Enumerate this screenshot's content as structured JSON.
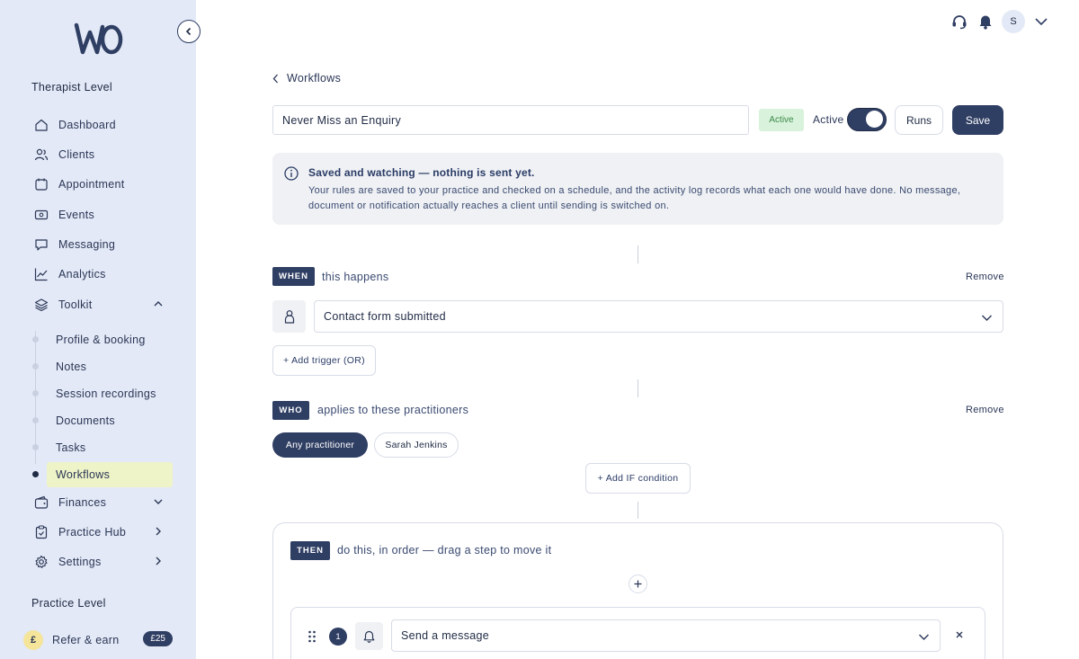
{
  "app": {
    "logo_text": "wo"
  },
  "sidebar": {
    "therapist_level": "Therapist Level",
    "practice_level": "Practice Level",
    "items": [
      {
        "label": "Dashboard",
        "icon": "home-icon"
      },
      {
        "label": "Clients",
        "icon": "users-icon"
      },
      {
        "label": "Appointment",
        "icon": "calendar-icon"
      },
      {
        "label": "Events",
        "icon": "ticket-icon"
      },
      {
        "label": "Messaging",
        "icon": "chat-icon"
      },
      {
        "label": "Analytics",
        "icon": "chart-icon"
      },
      {
        "label": "Toolkit",
        "icon": "layers-icon",
        "expanded": true
      }
    ],
    "toolkit_sub": [
      {
        "label": "Profile & booking"
      },
      {
        "label": "Notes"
      },
      {
        "label": "Session recordings"
      },
      {
        "label": "Documents"
      },
      {
        "label": "Tasks"
      },
      {
        "label": "Workflows",
        "active": true
      }
    ],
    "items_after": [
      {
        "label": "Finances",
        "icon": "wallet-icon"
      },
      {
        "label": "Practice Hub",
        "icon": "clipboard-icon"
      },
      {
        "label": "Settings",
        "icon": "gear-icon"
      }
    ],
    "refer": {
      "icon_text": "£",
      "label": "Refer & earn",
      "badge": "£25"
    }
  },
  "header": {
    "avatar_initial": "S"
  },
  "workflow": {
    "breadcrumb": "Workflows",
    "name": "Never Miss an Enquiry",
    "status_pill": "Active",
    "toggle_label": "Active",
    "toggle_on": true,
    "runs_label": "Runs",
    "save_label": "Save"
  },
  "notice": {
    "title": "Saved and watching — nothing is sent yet.",
    "body": "Your rules are saved to your practice and checked on a schedule, and the activity log records what each one would have done. No message, document or notification actually reaches a client until sending is switched on."
  },
  "when": {
    "tag": "WHEN",
    "text": "this happens",
    "remove": "Remove",
    "trigger": "Contact form submitted",
    "add_trigger": "+ Add trigger (OR)"
  },
  "who": {
    "tag": "WHO",
    "text": "applies to these practitioners",
    "remove": "Remove",
    "chips": [
      "Any practitioner",
      "Sarah Jenkins"
    ],
    "add_condition": "+ Add IF condition"
  },
  "then": {
    "tag": "THEN",
    "text": "do this, in order — drag a step to move it",
    "steps": [
      {
        "number": "1",
        "action": "Send a message"
      }
    ]
  }
}
